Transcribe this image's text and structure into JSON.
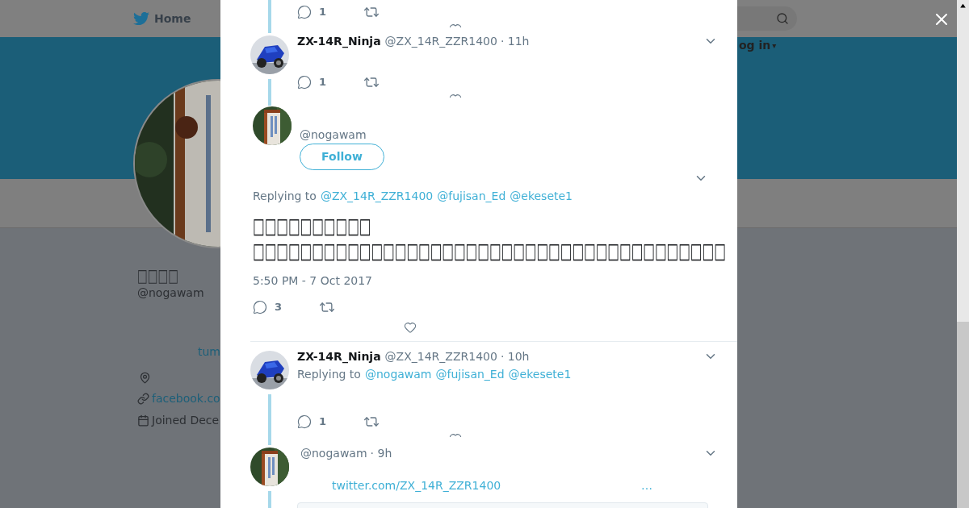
{
  "nav": {
    "home": "Home",
    "login": "og in",
    "login_caret": "▾"
  },
  "profile": {
    "name": "□□□□",
    "handle": "@nogawam",
    "link_1": "tum",
    "website": "facebook.co",
    "joined": "Joined Dece"
  },
  "tweets": [
    {
      "kind": "actions",
      "replies": "1"
    },
    {
      "kind": "tweet",
      "avatar": {
        "kind": "bike"
      },
      "name": "ZX-14R_Ninja",
      "handle": "@ZX_14R_ZZR1400",
      "time": "· 11h",
      "replies": "1"
    },
    {
      "kind": "focused",
      "avatar": {
        "kind": "sign"
      },
      "handle": "@nogawam",
      "follow": "Follow",
      "replying": "Replying to",
      "mentions": [
        "@ZX_14R_ZZR1400",
        "@fujisan_Ed",
        "@ekesete1"
      ],
      "text_lines": [
        "□□□□□□□□□□",
        "□□□□□□□□□□□□□□□□□□□□□□□□□□□□□□□□□□□□□□□□"
      ],
      "timestamp": "5:50 PM - 7 Oct 2017",
      "replies": "3"
    },
    {
      "kind": "tweet",
      "avatar": {
        "kind": "bike"
      },
      "name": "ZX-14R_Ninja",
      "handle": "@ZX_14R_ZZR1400",
      "time": "· 10h",
      "replying": "Replying to",
      "mentions": [
        "@nogawam",
        "@fujisan_Ed",
        "@ekesete1"
      ],
      "replies": "1"
    },
    {
      "kind": "partial",
      "avatar": {
        "kind": "sign"
      },
      "handle": "@nogawam",
      "time": "· 9h",
      "link": "twitter.com/ZX_14R_ZZR1400",
      "more": "…"
    }
  ]
}
